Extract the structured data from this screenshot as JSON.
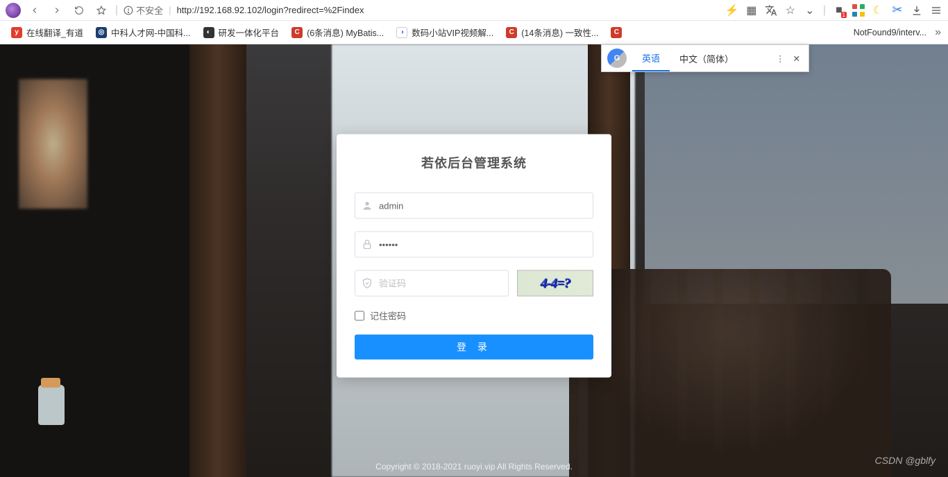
{
  "browser": {
    "insecure_label": "不安全",
    "url": "http://192.168.92.102/login?redirect=%2Findex"
  },
  "bookmarks": [
    {
      "label": "在线翻译_有道"
    },
    {
      "label": "中科人才网-中国科..."
    },
    {
      "label": "研发一体化平台"
    },
    {
      "label": "(6条消息) MyBatis..."
    },
    {
      "label": "数码小站VIP视频解..."
    },
    {
      "label": "(14条消息) 一致性..."
    },
    {
      "label": "NotFound9/interv..."
    }
  ],
  "translate_popup": {
    "lang_en": "英语",
    "lang_zh": "中文（简体）"
  },
  "login": {
    "title": "若依后台管理系统",
    "username_value": "admin",
    "password_value": "••••••",
    "captcha_placeholder": "验证码",
    "captcha_text": "4-4=?",
    "remember_label": "记住密码",
    "submit_label": "登 录"
  },
  "footer": {
    "copyright": "Copyright © 2018-2021 ruoyi.vip All Rights Reserved.",
    "watermark": "CSDN @gblfy"
  }
}
